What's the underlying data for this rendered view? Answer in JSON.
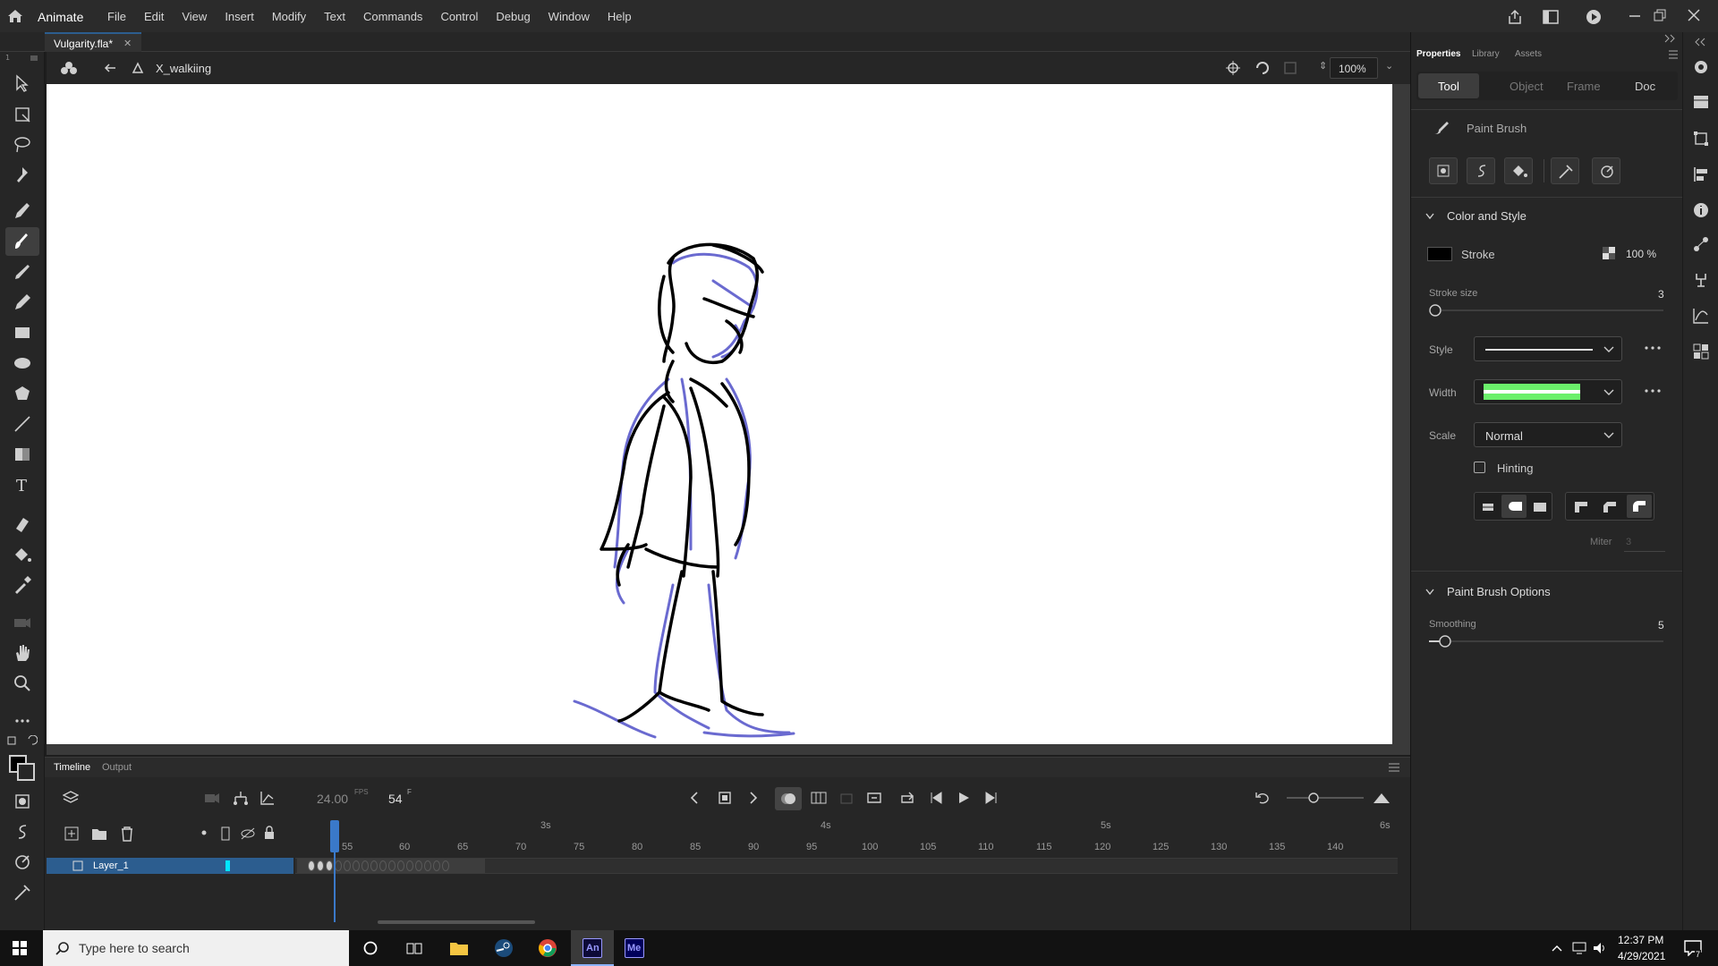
{
  "app": {
    "name": "Animate"
  },
  "menu": [
    "File",
    "Edit",
    "View",
    "Insert",
    "Modify",
    "Text",
    "Commands",
    "Control",
    "Debug",
    "Window",
    "Help"
  ],
  "document": {
    "tab": "Vulgarity.fla*",
    "scene": "X_walkiing",
    "zoom": "100%"
  },
  "properties": {
    "tabs": [
      "Properties",
      "Library",
      "Assets"
    ],
    "subtabs": [
      "Tool",
      "Object",
      "Frame",
      "Doc"
    ],
    "tool_name": "Paint Brush",
    "color_section": "Color and Style",
    "stroke_label": "Stroke",
    "stroke_color": "#000000",
    "stroke_alpha": "100 %",
    "stroke_size_label": "Stroke size",
    "stroke_size": "3",
    "style_label": "Style",
    "width_label": "Width",
    "scale_label": "Scale",
    "scale_value": "Normal",
    "hinting_label": "Hinting",
    "miter_label": "Miter",
    "miter_value": "3",
    "brush_section": "Paint Brush Options",
    "smoothing_label": "Smoothing",
    "smoothing_value": "5"
  },
  "timeline": {
    "tabs": [
      "Timeline",
      "Output"
    ],
    "fps": "24.00",
    "fps_unit": "FPS",
    "frame": "54",
    "frame_unit": "F",
    "layer": "Layer_1",
    "ticks": [
      "55",
      "60",
      "65",
      "70",
      "75",
      "80",
      "85",
      "90",
      "95",
      "100",
      "105",
      "110",
      "115",
      "120",
      "125",
      "130",
      "135",
      "140"
    ],
    "seconds": [
      "3s",
      "4s",
      "5s",
      "6s"
    ]
  },
  "taskbar": {
    "search_placeholder": "Type here to search",
    "time": "12:37 PM",
    "date": "4/29/2021",
    "notifications": "7",
    "app_labels": [
      "An",
      "Me"
    ]
  },
  "colors": {
    "accent": "#2c5d8f",
    "onion": "#6a6ad0"
  }
}
